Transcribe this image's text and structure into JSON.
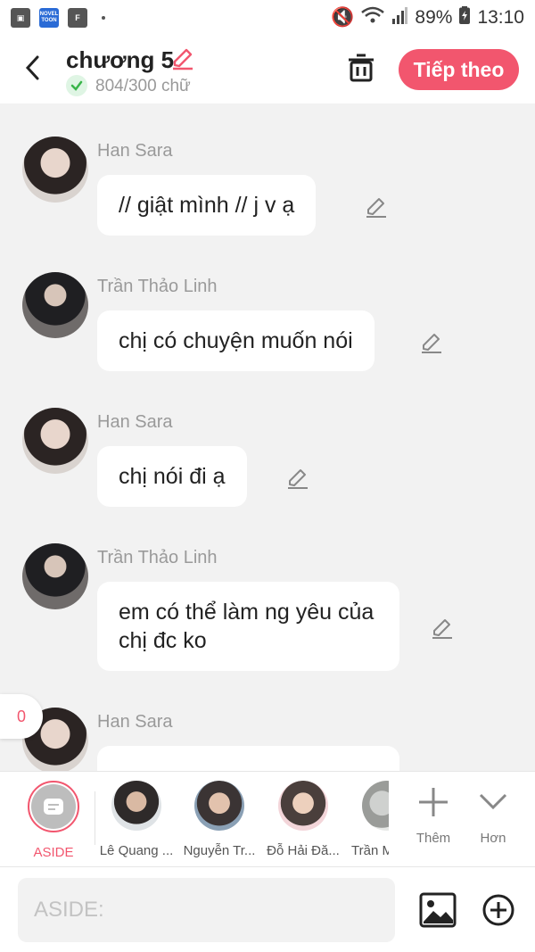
{
  "status_bar": {
    "battery": "89%",
    "time": "13:10",
    "novel_icon_text": "NOVEL TOON"
  },
  "header": {
    "title": "chương 5",
    "word_count": "804/300 chữ",
    "next_label": "Tiếp theo"
  },
  "messages": [
    {
      "name": "Han Sara",
      "text": "// giật mình // j v ạ"
    },
    {
      "name": "Trần Thảo Linh",
      "text": "chị có chuyện muốn nói"
    },
    {
      "name": "Han Sara",
      "text": "chị nói đi ạ"
    },
    {
      "name": "Trần Thảo Linh",
      "text": "em có thể làm ng yêu của chị đc ko"
    },
    {
      "name": "Han Sara",
      "text": ""
    }
  ],
  "unread_badge": "0",
  "characters": [
    {
      "label": "ASIDE"
    },
    {
      "label": "Lê Quang ..."
    },
    {
      "label": "Nguyễn Tr..."
    },
    {
      "label": "Đỗ Hải Đă..."
    },
    {
      "label": "Trần M"
    }
  ],
  "actions": {
    "add_label": "Thêm",
    "more_label": "Hơn"
  },
  "composer": {
    "placeholder": "ASIDE:"
  },
  "colors": {
    "accent": "#f2566e",
    "background": "#f2f2f2"
  }
}
